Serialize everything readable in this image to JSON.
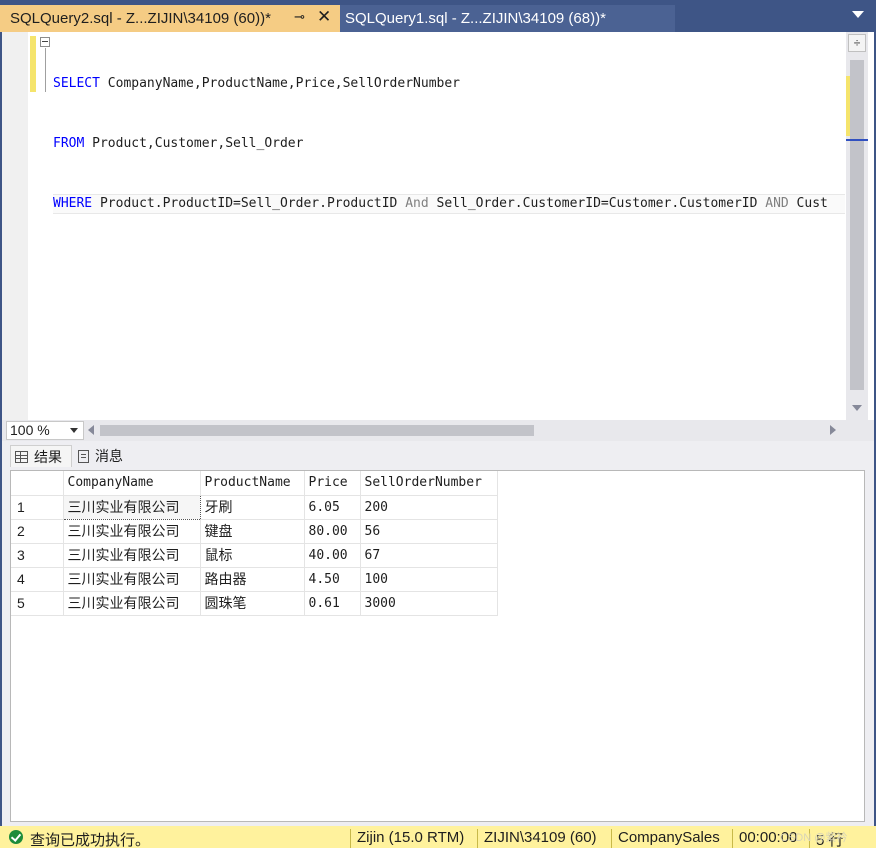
{
  "tabs": [
    {
      "label": "SQLQuery2.sql - Z...ZIJIN\\34109 (60))*",
      "active": true
    },
    {
      "label": "SQLQuery1.sql - Z...ZIJIN\\34109 (68))*",
      "active": false
    }
  ],
  "tab_icons": {
    "pin": "pin-icon",
    "close": "close-icon",
    "overflow": "chevron-down-icon"
  },
  "editor": {
    "line1": {
      "kw": "SELECT",
      "rest": " CompanyName,ProductName,Price,SellOrderNumber"
    },
    "line2": {
      "kw": "FROM",
      "rest": " Product,Customer,Sell_Order"
    },
    "line3": {
      "kw": "WHERE",
      "a": " Product.ProductID=Sell_Order.ProductID ",
      "and1": "And",
      "b": " Sell_Order.CustomerID=Customer.CustomerID ",
      "and2": "AND",
      "c": " Cust"
    }
  },
  "zoom": {
    "value": "100 %"
  },
  "results": {
    "tabs": [
      {
        "label": "结果",
        "icon": "grid-icon"
      },
      {
        "label": "消息",
        "icon": "message-icon"
      }
    ],
    "columns": [
      "CompanyName",
      "ProductName",
      "Price",
      "SellOrderNumber"
    ],
    "rows": [
      {
        "n": "1",
        "company": "三川实业有限公司",
        "product": "牙刷",
        "price": "6.05",
        "qty": "200"
      },
      {
        "n": "2",
        "company": "三川实业有限公司",
        "product": "键盘",
        "price": "80.00",
        "qty": "56"
      },
      {
        "n": "3",
        "company": "三川实业有限公司",
        "product": "鼠标",
        "price": "40.00",
        "qty": "67"
      },
      {
        "n": "4",
        "company": "三川实业有限公司",
        "product": "路由器",
        "price": "4.50",
        "qty": "100"
      },
      {
        "n": "5",
        "company": "三川实业有限公司",
        "product": "圆珠笔",
        "price": "0.61",
        "qty": "3000"
      }
    ]
  },
  "status": {
    "message": "查询已成功执行。",
    "server": "Zijin (15.0 RTM)",
    "user": "ZIJIN\\34109 (60)",
    "database": "CompanySales",
    "elapsed": "00:00:00",
    "rows": "5 行",
    "watermark": "CSDN @紫衿"
  },
  "colors": {
    "tab_active": "#f5cc84",
    "chrome": "#3e5586",
    "status": "#fff29d",
    "keyword": "#0000ff"
  }
}
